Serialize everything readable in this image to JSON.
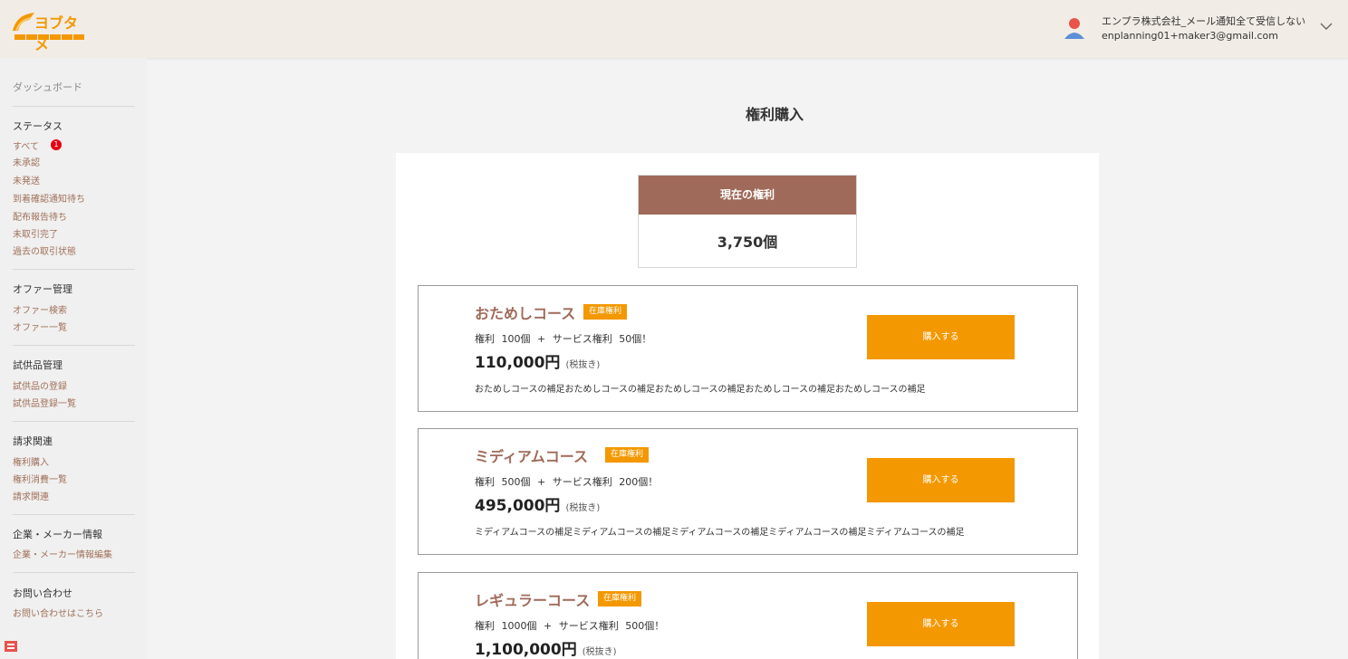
{
  "header": {
    "logo_text": "ヨブタメ",
    "user_name": "エンプラ株式会社_メール通知全て受信しない",
    "user_email": "enplanning01+maker3@gmail.com",
    "avatar_icon": "user-avatar-icon",
    "menu_icon": "chevron-down-icon"
  },
  "sidebar": {
    "dashboard": "ダッシュボード",
    "status_heading": "ステータス",
    "status_items": [
      "すべて",
      "未承認",
      "未発送",
      "到着確認通知待ち",
      "配布報告待ち",
      "未取引完了",
      "過去の取引状態"
    ],
    "all_count": "1",
    "offer_heading": "オファー管理",
    "offer_items": [
      "オファー検索",
      "オファー一覧"
    ],
    "sample_heading": "試供品管理",
    "sample_items": [
      "試供品の登録",
      "試供品登録一覧"
    ],
    "billing_heading": "請求関連",
    "billing_items": [
      "権利購入",
      "権利消費一覧",
      "請求関連"
    ],
    "company_heading": "企業・メーカー情報",
    "company_items": [
      "企業・メーカー情報編集"
    ],
    "contact_heading": "お問い合わせ",
    "contact_items": [
      "お問い合わせはこちら"
    ]
  },
  "main": {
    "title": "権利購入",
    "current_label": "現在の権利",
    "current_value": "3,750個",
    "courses": [
      {
        "name": "おためしコース",
        "badge": "在庫権利",
        "detail": "権利 100個 + サービス権利 50個！",
        "price": "110,000円",
        "tax": "(税抜き)",
        "note": "おためしコースの補足おためしコースの補足おためしコースの補足おためしコースの補足おためしコースの補足",
        "button": "購入する"
      },
      {
        "name": "ミディアムコース",
        "badge": "在庫権利",
        "detail": "権利 500個 + サービス権利 200個！",
        "price": "495,000円",
        "tax": "(税抜き)",
        "note": "ミディアムコースの補足ミディアムコースの補足ミディアムコースの補足ミディアムコースの補足ミディアムコースの補足",
        "button": "購入する"
      },
      {
        "name": "レギュラーコース",
        "badge": "在庫権利",
        "detail": "権利 1000個 + サービス権利 500個！",
        "price": "1,100,000円",
        "tax": "(税抜き)",
        "note": "",
        "button": "購入する"
      }
    ]
  },
  "colors": {
    "accent": "#f39800",
    "brown": "#a06a5a",
    "badge_red": "#e60012"
  }
}
